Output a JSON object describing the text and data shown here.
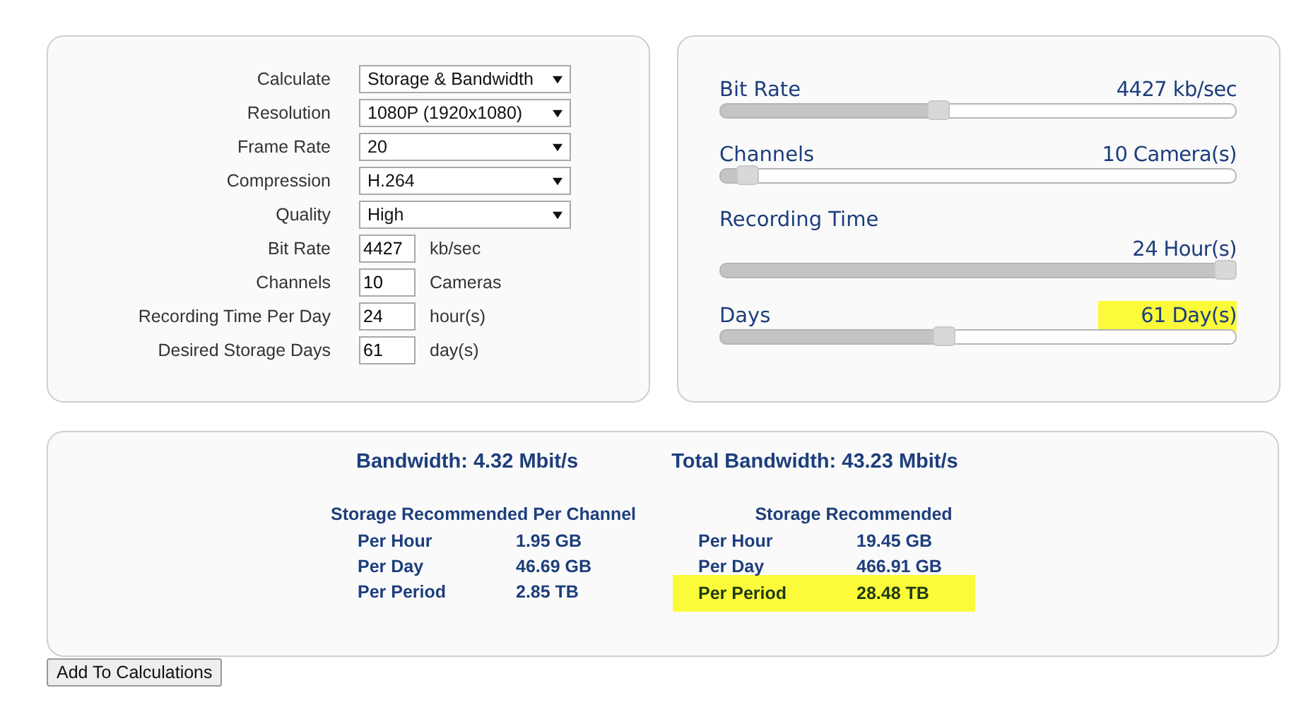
{
  "form": {
    "fields": [
      {
        "kind": "select",
        "label": "Calculate",
        "value": "Storage & Bandwidth"
      },
      {
        "kind": "select",
        "label": "Resolution",
        "value": "1080P (1920x1080)"
      },
      {
        "kind": "select",
        "label": "Frame Rate",
        "value": "20"
      },
      {
        "kind": "select",
        "label": "Compression",
        "value": "H.264"
      },
      {
        "kind": "select",
        "label": "Quality",
        "value": "High"
      },
      {
        "kind": "input",
        "label": "Bit Rate",
        "value": "4427",
        "unit": "kb/sec"
      },
      {
        "kind": "input",
        "label": "Channels",
        "value": "10",
        "unit": "Cameras"
      },
      {
        "kind": "input",
        "label": "Recording Time Per Day",
        "value": "24",
        "unit": "hour(s)"
      },
      {
        "kind": "input",
        "label": "Desired Storage Days",
        "value": "61",
        "unit": "day(s)"
      }
    ]
  },
  "sliders": [
    {
      "kind": "inline",
      "label": "Bit Rate",
      "reading": "4427 kb/sec",
      "level": 0.42,
      "highlighted": false
    },
    {
      "kind": "inline",
      "label": "Channels",
      "reading": "10 Camera(s)",
      "level": 0.035,
      "highlighted": false
    },
    {
      "kind": "stacked",
      "label": "Recording Time",
      "reading": "24 Hour(s)",
      "level": 1,
      "highlighted": false
    },
    {
      "kind": "inline",
      "label": "Days",
      "reading": "61 Day(s)",
      "level": 0.43,
      "highlighted": true
    }
  ],
  "results": {
    "bandwidth": "Bandwidth: 4.32 Mbit/s",
    "total_bandwidth": "Total Bandwidth: 43.23 Mbit/s",
    "tables": [
      {
        "title": "Storage Recommended Per Channel",
        "rows": [
          {
            "label": "Per Hour",
            "value": "1.95 GB",
            "highlighted": false
          },
          {
            "label": "Per Day",
            "value": "46.69 GB",
            "highlighted": false
          },
          {
            "label": "Per Period",
            "value": "2.85 TB",
            "highlighted": false
          }
        ]
      },
      {
        "title": "Storage Recommended",
        "rows": [
          {
            "label": "Per Hour",
            "value": "19.45 GB",
            "highlighted": false
          },
          {
            "label": "Per Day",
            "value": "466.91 GB",
            "highlighted": false
          },
          {
            "label": "Per Period",
            "value": "28.48 TB",
            "highlighted": true
          }
        ]
      }
    ]
  },
  "button": "Add To Calculations"
}
